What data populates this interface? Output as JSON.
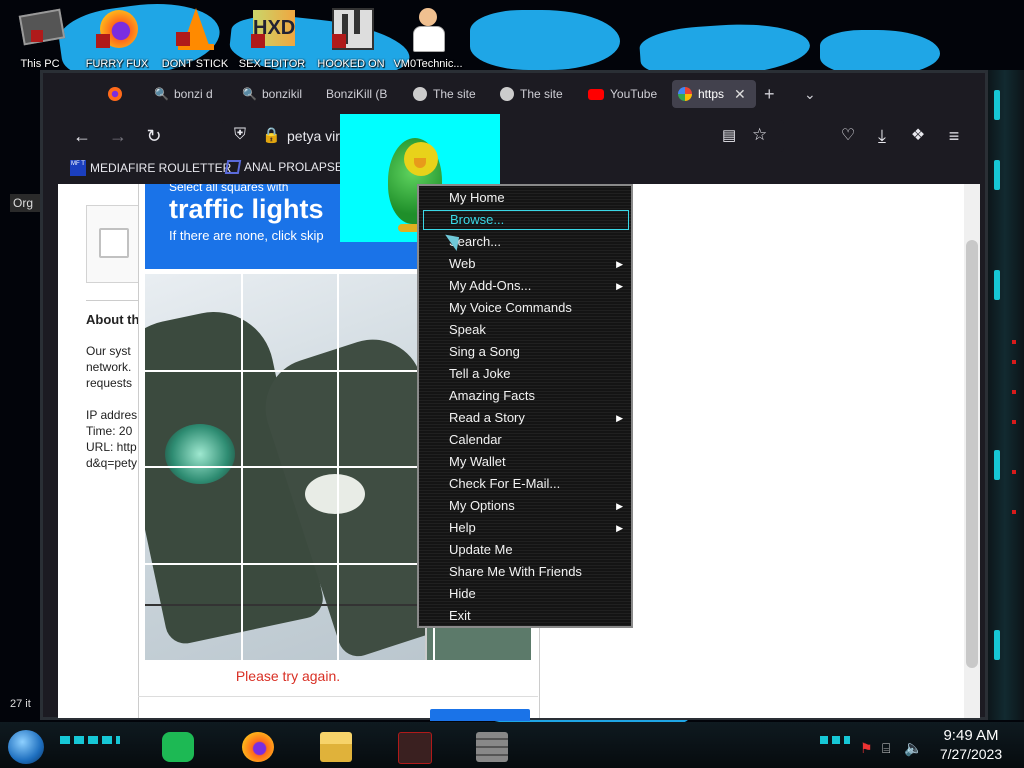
{
  "desktop": {
    "icons": [
      {
        "label": "This PC",
        "icon": "this-pc-icon"
      },
      {
        "label": "FURRY FUX",
        "icon": "firefox-icon"
      },
      {
        "label": "DONT STICK",
        "icon": "vlc-cone-icon"
      },
      {
        "label": "SEX EDITOR",
        "icon": "hxd-editor-icon"
      },
      {
        "label": "HOOKED ON",
        "icon": "maze-game-icon"
      },
      {
        "label": "VM0Technic...",
        "icon": "doctor-icon"
      }
    ],
    "left_labels": [
      "Org",
      "27 it"
    ]
  },
  "browser": {
    "tabs": [
      {
        "label": "",
        "icon": "firefox-icon"
      },
      {
        "label": "bonzi d",
        "icon": "search-icon"
      },
      {
        "label": "bonzikil",
        "icon": "search-icon"
      },
      {
        "label": "BonziKill (B",
        "icon": ""
      },
      {
        "label": "The site",
        "icon": "globe-icon"
      },
      {
        "label": "The site",
        "icon": "globe-icon"
      },
      {
        "label": "YouTube",
        "icon": "youtube-icon"
      },
      {
        "label": "https",
        "icon": "google-icon"
      }
    ],
    "url_text": "petya vir",
    "bookmarks": [
      {
        "label": "MEDIAFIRE ROULETTER",
        "badge": "MF T"
      },
      {
        "label": "ANAL PROLAPSE",
        "badge": ""
      }
    ]
  },
  "page": {
    "about_title": "About th",
    "about_lines": [
      "Our syst",
      "network.",
      "requests",
      "",
      "IP addres",
      "Time: 20",
      "URL: http",
      "d&q=pety"
    ],
    "challenge": {
      "subtitle": "Select all squares with",
      "title": "traffic lights",
      "hint": "If there are none, click skip",
      "error": "Please try again."
    }
  },
  "bonzi_menu": {
    "items": [
      {
        "label": "My Home",
        "submenu": false,
        "highlighted": false
      },
      {
        "label": "Browse...",
        "submenu": false,
        "highlighted": true
      },
      {
        "label": "Search...",
        "submenu": false,
        "highlighted": false
      },
      {
        "label": "Web",
        "submenu": true,
        "highlighted": false
      },
      {
        "label": "My Add-Ons...",
        "submenu": true,
        "highlighted": false
      },
      {
        "label": "My Voice Commands",
        "submenu": false,
        "highlighted": false
      },
      {
        "label": "Speak",
        "submenu": false,
        "highlighted": false
      },
      {
        "label": "Sing a Song",
        "submenu": false,
        "highlighted": false
      },
      {
        "label": "Tell a Joke",
        "submenu": false,
        "highlighted": false
      },
      {
        "label": "Amazing Facts",
        "submenu": false,
        "highlighted": false
      },
      {
        "label": "Read a Story",
        "submenu": true,
        "highlighted": false
      },
      {
        "label": "Calendar",
        "submenu": false,
        "highlighted": false
      },
      {
        "label": "My Wallet",
        "submenu": false,
        "highlighted": false
      },
      {
        "label": "Check For E-Mail...",
        "submenu": false,
        "highlighted": false
      },
      {
        "label": "My Options",
        "submenu": true,
        "highlighted": false
      },
      {
        "label": "Help",
        "submenu": true,
        "highlighted": false
      },
      {
        "label": "Update Me",
        "submenu": false,
        "highlighted": false
      },
      {
        "label": "Share Me With Friends",
        "submenu": false,
        "highlighted": false
      },
      {
        "label": "Hide",
        "submenu": false,
        "highlighted": false
      },
      {
        "label": "Exit",
        "submenu": false,
        "highlighted": false
      }
    ]
  },
  "taskbar": {
    "time": "9:49 AM",
    "date": "7/27/2023",
    "apps": [
      "spotify-icon",
      "firefox-icon",
      "file-explorer-icon",
      "gamepad-app-icon",
      "brick-wall-app-icon"
    ],
    "tray": [
      "flag-icon",
      "network-icon",
      "volume-icon"
    ]
  },
  "colors": {
    "accent_blue": "#1a73e8",
    "bonzi_bg": "#00ffff",
    "menu_highlight": "#3ad8e6",
    "error_red": "#d93025"
  }
}
